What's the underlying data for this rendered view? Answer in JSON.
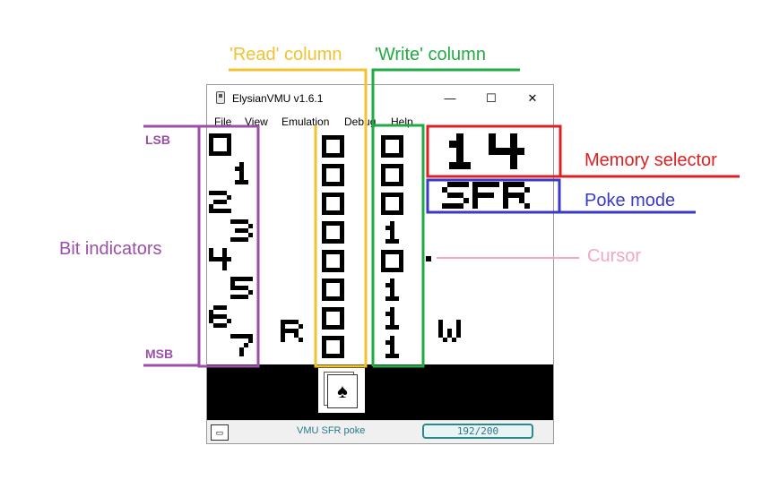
{
  "window": {
    "title": "ElysianVMU v1.6.1",
    "minimize_glyph": "—",
    "maximize_glyph": "☐",
    "close_glyph": "✕"
  },
  "menu": [
    "File",
    "View",
    "Emulation",
    "Debug",
    "Help"
  ],
  "status": {
    "mode_text": "VMU SFR poke",
    "counter": "192/200"
  },
  "annotations": {
    "read_column": "'Read' column",
    "write_column": "'Write' column",
    "memory_selector": "Memory selector",
    "poke_mode": "Poke mode",
    "cursor": "Cursor",
    "bit_indicators": "Bit indicators",
    "lsb": "LSB",
    "msb": "MSB"
  },
  "colors": {
    "purple": "#9b4fa8",
    "yellow": "#f2c230",
    "green": "#22aa44",
    "red": "#e02020",
    "blue": "#3a3ac8",
    "pink": "#f4a6c2"
  },
  "lcd": {
    "bit_digits": [
      "0",
      "1",
      "2",
      "3",
      "4",
      "5",
      "6",
      "7"
    ],
    "read_values": [
      "0",
      "0",
      "0",
      "0",
      "0",
      "0",
      "0",
      "0"
    ],
    "write_values": [
      "0",
      "0",
      "0",
      "1",
      "0",
      "1",
      "1",
      "1"
    ],
    "memory_selector": "14",
    "poke_mode": "SFR",
    "bottom_icons": [
      "R",
      "W"
    ]
  }
}
